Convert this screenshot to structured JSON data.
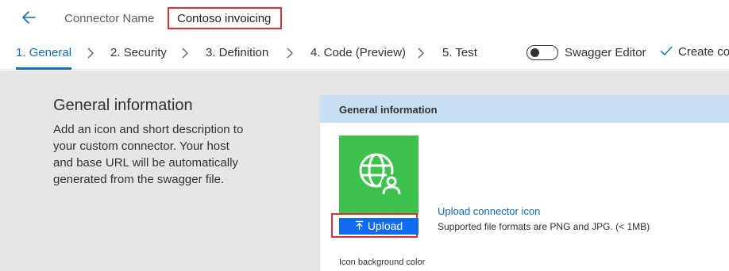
{
  "header": {
    "connector_name_label": "Connector Name",
    "connector_name_value": "Contoso invoicing"
  },
  "steps": [
    {
      "label": "1. General",
      "active": true
    },
    {
      "label": "2. Security",
      "active": false
    },
    {
      "label": "3. Definition",
      "active": false
    },
    {
      "label": "4. Code (Preview)",
      "active": false
    },
    {
      "label": "5. Test",
      "active": false
    }
  ],
  "toolbar": {
    "swagger_editor_label": "Swagger Editor",
    "swagger_editor_on": false,
    "create_label": "Create co"
  },
  "intro": {
    "title": "General information",
    "description": "Add an icon and short description to your custom connector. Your host and base URL will be automatically generated from the swagger file."
  },
  "panel": {
    "header": "General information",
    "upload_button_label": "Upload",
    "upload_link_label": "Upload connector icon",
    "upload_hint": "Supported file formats are PNG and JPG. (< 1MB)",
    "icon_bg_label": "Icon background color"
  },
  "colors": {
    "accent": "#0f6cbd",
    "icon_tile": "#3cc24d",
    "highlight": "#d13438",
    "panel_header": "#c7e0f4",
    "content_bg": "#e6e6e6"
  },
  "icons": {
    "back": "arrow-left-icon",
    "chevron": "chevron-right-icon",
    "create": "checkmark-icon",
    "connector": "globe-person-icon",
    "upload": "upload-arrow-icon"
  }
}
